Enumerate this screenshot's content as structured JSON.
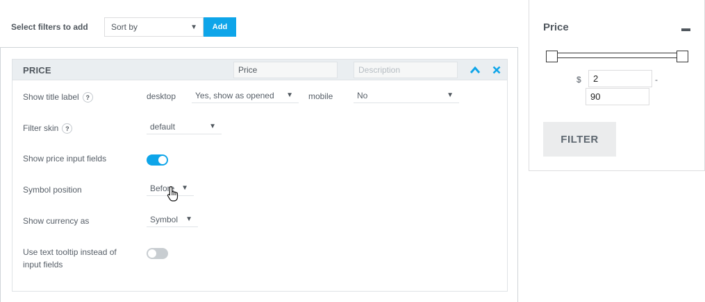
{
  "toolbar": {
    "label": "Select filters to add",
    "sort_value": "Sort by",
    "add_label": "Add"
  },
  "card": {
    "title": "PRICE",
    "title_input": "Price",
    "description_placeholder": "Description"
  },
  "rows": {
    "show_title_label": {
      "label": "Show title label",
      "desktop_label": "desktop",
      "desktop_value": "Yes, show as opened",
      "mobile_label": "mobile",
      "mobile_value": "No"
    },
    "filter_skin": {
      "label": "Filter skin",
      "value": "default"
    },
    "show_price_inputs": {
      "label": "Show price input fields",
      "enabled": true
    },
    "symbol_position": {
      "label": "Symbol position",
      "value": "Before"
    },
    "show_currency_as": {
      "label": "Show currency as",
      "value": "Symbol"
    },
    "text_tooltip": {
      "label_line1": "Use text tooltip instead of",
      "label_line2": "input fields",
      "enabled": false
    }
  },
  "help_glyph": "?",
  "widget": {
    "title": "Price",
    "currency_symbol": "$",
    "min_value": "2",
    "max_value": "90",
    "separator": "-",
    "filter_label": "FILTER"
  },
  "colors": {
    "accent": "#0ea5e9",
    "toggle_off": "#c8cdd1",
    "header_bg": "#eaeef1"
  },
  "icons": [
    "chevron-up-icon",
    "close-icon",
    "help-icon",
    "caret-down-icon",
    "minus-icon",
    "hand-pointer-icon"
  ]
}
